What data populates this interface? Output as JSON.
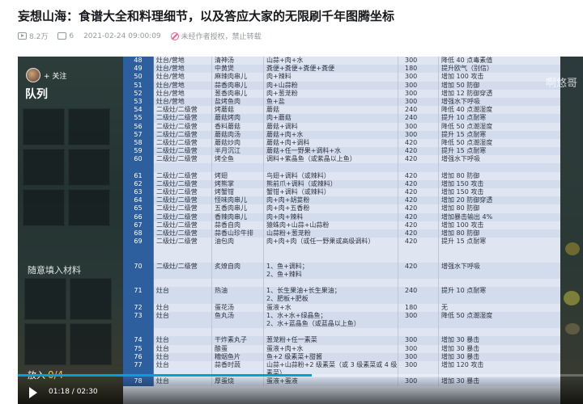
{
  "title": "妄想山海：食谱大全和料理细节，以及答应大家的无限刷千年图腾坐标",
  "meta": {
    "views": "8.2万",
    "danmaku": "6",
    "datetime": "2021-02-24 09:00:09",
    "notice": "未经作者授权，禁止转载"
  },
  "overlay": {
    "follow": "+ 关注",
    "team": "队列",
    "materials": "随意填入材料",
    "put_label": "放入",
    "put_count": "0/4",
    "watermark": "啊悠哥"
  },
  "player": {
    "current_time": "01:18",
    "duration": "02:30",
    "progress": 0.52
  },
  "recipes": [
    {
      "no": "48",
      "place": "灶台/营地",
      "name": "清神汤",
      "ing": "山蒜+肉+水",
      "time": "300",
      "effect": "降低 40 点毒素值"
    },
    {
      "no": "49",
      "place": "灶台/营地",
      "name": "中黄煲",
      "ing": "粪便+粪便+粪便+粪便",
      "time": "180",
      "effect": "提升欧气（别信）"
    },
    {
      "no": "50",
      "place": "灶台/营地",
      "name": "麻辣肉串儿",
      "ing": "肉+辣料",
      "time": "300",
      "effect": "增加 100 攻击"
    },
    {
      "no": "51",
      "place": "灶台/营地",
      "name": "蒜香肉串儿",
      "ing": "肉+山蒜粉",
      "time": "300",
      "effect": "增加 50 防御"
    },
    {
      "no": "52",
      "place": "灶台/营地",
      "name": "葱香肉串儿",
      "ing": "肉+葱茏粉",
      "time": "300",
      "effect": "增加 12 防御穿透"
    },
    {
      "no": "53",
      "place": "灶台/营地",
      "name": "盐烤鱼肉",
      "ing": "鱼+盐",
      "time": "300",
      "effect": "增强水下呼吸"
    },
    {
      "no": "54",
      "place": "二级灶/二级营",
      "name": "烤蘑菇",
      "ing": "蘑菇",
      "time": "240",
      "effect": "降低 40 点潮湿度"
    },
    {
      "no": "55",
      "place": "二级灶/二级营",
      "name": "蘑菇烤肉",
      "ing": "肉+蘑菇",
      "time": "240",
      "effect": "提升 10 点耐寒"
    },
    {
      "no": "56",
      "place": "二级灶/二级营",
      "name": "香料蘑菇",
      "ing": "蘑菇+调料",
      "time": "300",
      "effect": "降低 50 点潮湿度"
    },
    {
      "no": "57",
      "place": "二级灶/二级营",
      "name": "蘑菇肉汤",
      "ing": "蘑菇+肉+水",
      "time": "300",
      "effect": "提升 15 点耐寒"
    },
    {
      "no": "58",
      "place": "二级灶/二级营",
      "name": "蘑菇炒肉",
      "ing": "蘑菇+肉+调料",
      "time": "420",
      "effect": "降低 50 点潮湿度"
    },
    {
      "no": "59",
      "place": "二级灶/二级营",
      "name": "半月沉江",
      "ing": "蘑菇+任一野果+调料+水",
      "time": "420",
      "effect": "提升 15 点耐寒"
    },
    {
      "no": "60",
      "place": "二级灶/二级营",
      "name": "烤全鱼",
      "ing": "调料+紫晶鱼（或紫晶以上鱼）",
      "time": "420",
      "effect": "增强水下呼吸"
    },
    {
      "no": "",
      "place": "",
      "name": "",
      "ing": "",
      "time": "",
      "effect": ""
    },
    {
      "no": "61",
      "place": "二级灶/二级营",
      "name": "烤翅",
      "ing": "鸟翅+调料（或辣料）",
      "time": "420",
      "effect": "增加 80 防御"
    },
    {
      "no": "62",
      "place": "二级灶/二级营",
      "name": "烤熊掌",
      "ing": "熊前爪+调料（或辣料）",
      "time": "420",
      "effect": "增加 150 攻击"
    },
    {
      "no": "63",
      "place": "二级灶/二级营",
      "name": "烤蟹钳",
      "ing": "蟹钳+调料（或辣料）",
      "time": "420",
      "effect": "增加 150 攻击"
    },
    {
      "no": "64",
      "place": "二级灶/二级营",
      "name": "怪味肉串儿",
      "ing": "肉+肉+胡荽粉",
      "time": "420",
      "effect": "增加 20 防御穿透"
    },
    {
      "no": "65",
      "place": "二级灶/二级营",
      "name": "五香肉串儿",
      "ing": "肉+肉+五香粉",
      "time": "420",
      "effect": "增加 80 防御"
    },
    {
      "no": "66",
      "place": "二级灶/二级营",
      "name": "香辣肉串儿",
      "ing": "肉+肉+辣料",
      "time": "420",
      "effect": "增加暴击输出 4%"
    },
    {
      "no": "67",
      "place": "二级灶/二级营",
      "name": "蒜香自肉",
      "ing": "猿蛛肉+山蒜+山蒜粉",
      "time": "420",
      "effect": "增加 100 攻击"
    },
    {
      "no": "68",
      "place": "二级灶/二级营",
      "name": "蒜香山珍牛排",
      "ing": "山蒜粉+葱茏粉",
      "time": "420",
      "effect": "增加 80 防御"
    },
    {
      "no": "69",
      "place": "二级灶/二级营",
      "name": "油包肉",
      "ing": "肉+肉+肉（或任一野果或高级调料）",
      "time": "420",
      "effect": "提升 15 点耐寒",
      "h": 3
    },
    {
      "no": "70",
      "place": "二级灶/二级营",
      "name": "炙燎自肉",
      "ing": "1、鱼+调料；\n2、鱼+辣料",
      "time": "420",
      "effect": "增强水下呼吸",
      "h": 2
    },
    {
      "no": "",
      "place": "",
      "name": "",
      "ing": "",
      "time": "",
      "effect": ""
    },
    {
      "no": "71",
      "place": "灶台",
      "name": "热油",
      "ing": "1、长生果油+长生果油；\n2、肥板+肥板",
      "time": "240",
      "effect": "提升 10 点耐寒",
      "h": 2
    },
    {
      "no": "72",
      "place": "灶台",
      "name": "蛋花汤",
      "ing": "蛋液+水",
      "time": "180",
      "effect": "无"
    },
    {
      "no": "73",
      "place": "灶台",
      "name": "鱼丸汤",
      "ing": "1、水+水+绿晶鱼；\n2、水+蓝晶鱼（或蓝晶以上鱼）",
      "time": "300",
      "effect": "降低 50 点潮湿度",
      "h": 2
    },
    {
      "no": "",
      "place": "",
      "name": "",
      "ing": "",
      "time": "",
      "effect": ""
    },
    {
      "no": "74",
      "place": "灶台",
      "name": "干炸素丸子",
      "ing": "葱茏粉+任一素菜",
      "time": "300",
      "effect": "增加 30 暴击"
    },
    {
      "no": "75",
      "place": "灶台",
      "name": "酿蛋",
      "ing": "蛋液+肉+水",
      "time": "300",
      "effect": "增加 30 暴击"
    },
    {
      "no": "76",
      "place": "灶台",
      "name": "糟烟鱼片",
      "ing": "鱼+2 级素菜+甜酱",
      "time": "300",
      "effect": "增加 30 暴击"
    },
    {
      "no": "77",
      "place": "灶台",
      "name": "蒜香时蔬",
      "ing": "山蒜+山蒜粉+2 级素菜（或 3 级素菜或 4 级素菜）",
      "time": "300",
      "effect": "增加 120 攻击",
      "h": 2
    },
    {
      "no": "78",
      "place": "灶台",
      "name": "厚蛋烧",
      "ing": "蛋液+蛋液",
      "time": "300",
      "effect": "增加 30 暴击"
    }
  ]
}
